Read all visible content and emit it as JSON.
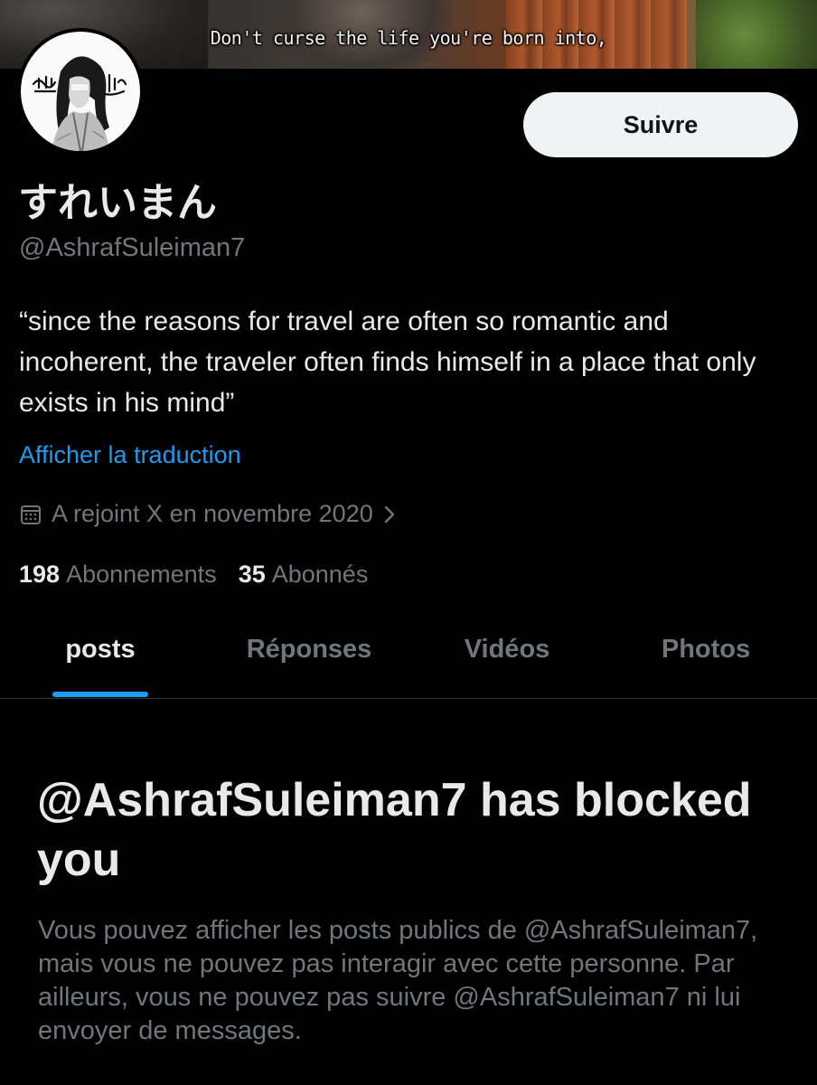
{
  "banner": {
    "subtitle": "Don't curse the life you're born into,"
  },
  "profile": {
    "display_name": "すれいまん",
    "handle": "@AshrafSuleiman7",
    "bio": "“since the reasons for travel are often so romantic and incoherent, the traveler often finds himself in a place that only exists in his mind”",
    "translate_label": "Afficher la traduction",
    "joined": "A rejoint X en novembre 2020",
    "follow_label": "Suivre",
    "following_count": "198",
    "following_label": "Abonnements",
    "followers_count": "35",
    "followers_label": "Abonnés"
  },
  "tabs": [
    {
      "label": "posts",
      "active": true
    },
    {
      "label": "Réponses",
      "active": false
    },
    {
      "label": "Vidéos",
      "active": false
    },
    {
      "label": "Photos",
      "active": false
    }
  ],
  "blocked": {
    "title": "@AshrafSuleiman7 has blocked you",
    "body": "Vous pouvez afficher les posts publics de @AshrafSuleiman7, mais vous ne pouvez pas interagir avec cette personne. Par ailleurs, vous ne pouvez pas suivre @AshrafSuleiman7 ni lui envoyer de messages."
  },
  "colors": {
    "background": "#000000",
    "text_primary": "#e7e9ea",
    "text_secondary": "#71767b",
    "accent": "#1d9bf0",
    "button_bg": "#eff3f4"
  },
  "icons": {
    "calendar": "calendar-icon",
    "chevron": "chevron-right-icon"
  }
}
